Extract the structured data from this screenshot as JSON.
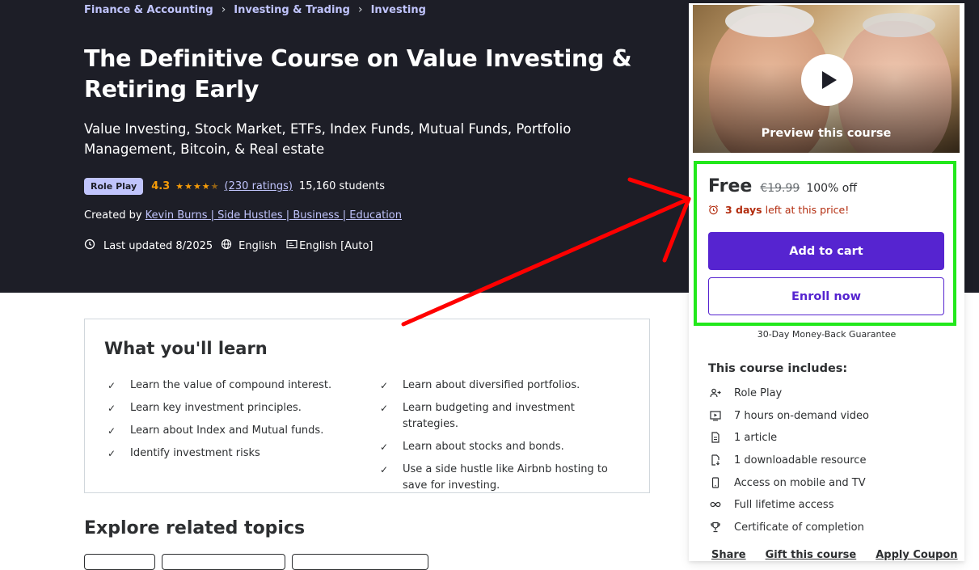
{
  "breadcrumb": [
    "Finance & Accounting",
    "Investing & Trading",
    "Investing"
  ],
  "course": {
    "title": "The Definitive Course on Value Investing & Retiring Early",
    "subtitle": "Value Investing, Stock Market, ETFs, Index Funds, Mutual Funds, Portfolio Management, Bitcoin, & Real estate",
    "badge": "Role Play",
    "rating": "4.3",
    "stars": 4.3,
    "rating_count": "(230 ratings)",
    "students": "15,160 students",
    "created_by_label": "Created by",
    "instructor": "Kevin Burns | Side Hustles | Business | Education",
    "last_updated": "Last updated 8/2025",
    "language": "English",
    "captions": "English [Auto]"
  },
  "learn": {
    "title": "What you'll learn",
    "left": [
      "Learn the value of compound interest.",
      "Learn key investment principles.",
      "Learn about Index and Mutual funds.",
      "Identify investment risks"
    ],
    "right": [
      "Learn about diversified portfolios.",
      "Learn budgeting and investment strategies.",
      "Learn about stocks and bonds.",
      "Use a side hustle like Airbnb hosting to save for investing."
    ]
  },
  "explore": {
    "title": "Explore related topics"
  },
  "sidebar": {
    "preview_label": "Preview this course",
    "price": "Free",
    "original_price": "€19.99",
    "discount": "100% off",
    "timer_bold": "3 days",
    "timer_rest": " left at this price!",
    "add_to_cart": "Add to cart",
    "enroll": "Enroll now",
    "guarantee": "30-Day Money-Back Guarantee",
    "includes_title": "This course includes:",
    "includes": [
      {
        "icon": "role-play-icon",
        "label": "Role Play"
      },
      {
        "icon": "video-icon",
        "label": "7 hours on-demand video"
      },
      {
        "icon": "article-icon",
        "label": "1 article"
      },
      {
        "icon": "download-file-icon",
        "label": "1 downloadable resource"
      },
      {
        "icon": "mobile-icon",
        "label": "Access on mobile and TV"
      },
      {
        "icon": "infinity-icon",
        "label": "Full lifetime access"
      },
      {
        "icon": "trophy-icon",
        "label": "Certificate of completion"
      }
    ],
    "actions": [
      "Share",
      "Gift this course",
      "Apply Coupon"
    ]
  },
  "colors": {
    "hero_bg": "#1d1e27",
    "accent_purple": "#5624d0",
    "link_lavender": "#c0c4fc",
    "star_orange": "#f69c08",
    "timer_red": "#b32d0f",
    "annotation_green": "#22e81c",
    "annotation_red": "#ff0000"
  }
}
